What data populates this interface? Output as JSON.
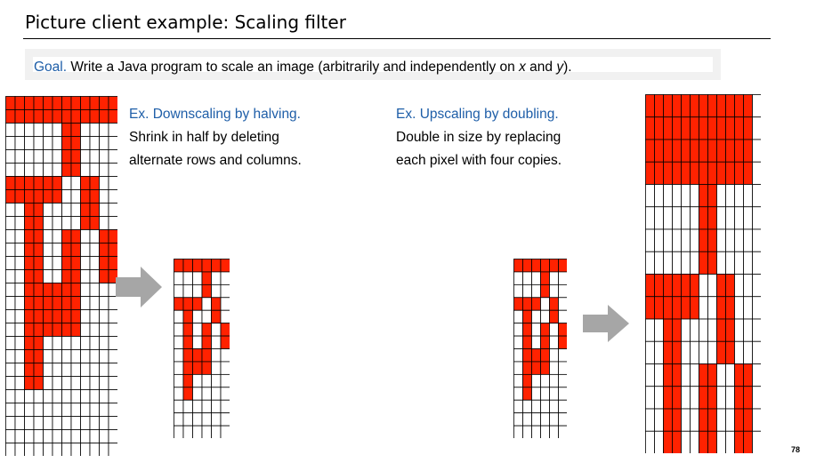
{
  "title": "Picture client example: Scaling filter",
  "goal": {
    "label": "Goal.",
    "text_before": " Write a Java program to scale an image (arbitrarily and independently on ",
    "var_x": "x",
    "text_middle": " and ",
    "var_y": "y",
    "text_after": ")."
  },
  "downscale": {
    "heading": "Ex. Downscaling by halving.",
    "line1": "Shrink in half by deleting",
    "line2": "alternate rows and columns."
  },
  "upscale": {
    "heading": "Ex. Upscaling by doubling.",
    "line1": "Double in size by replacing",
    "line2": "each pixel with four copies."
  },
  "page_number": "78",
  "colors": {
    "accent": "#1e5ea8",
    "pixel_fill": "#ff2200",
    "grid_line": "#000000",
    "arrow": "#a6a6a6"
  },
  "icons": {
    "arrow": "arrow-right-icon"
  },
  "pattern": [
    "000000",
    "000100",
    "000100",
    "111010",
    "010010",
    "010101",
    "010101",
    "011100",
    "011100",
    "010000",
    "010000"
  ],
  "pattern_top_rows": 1
}
